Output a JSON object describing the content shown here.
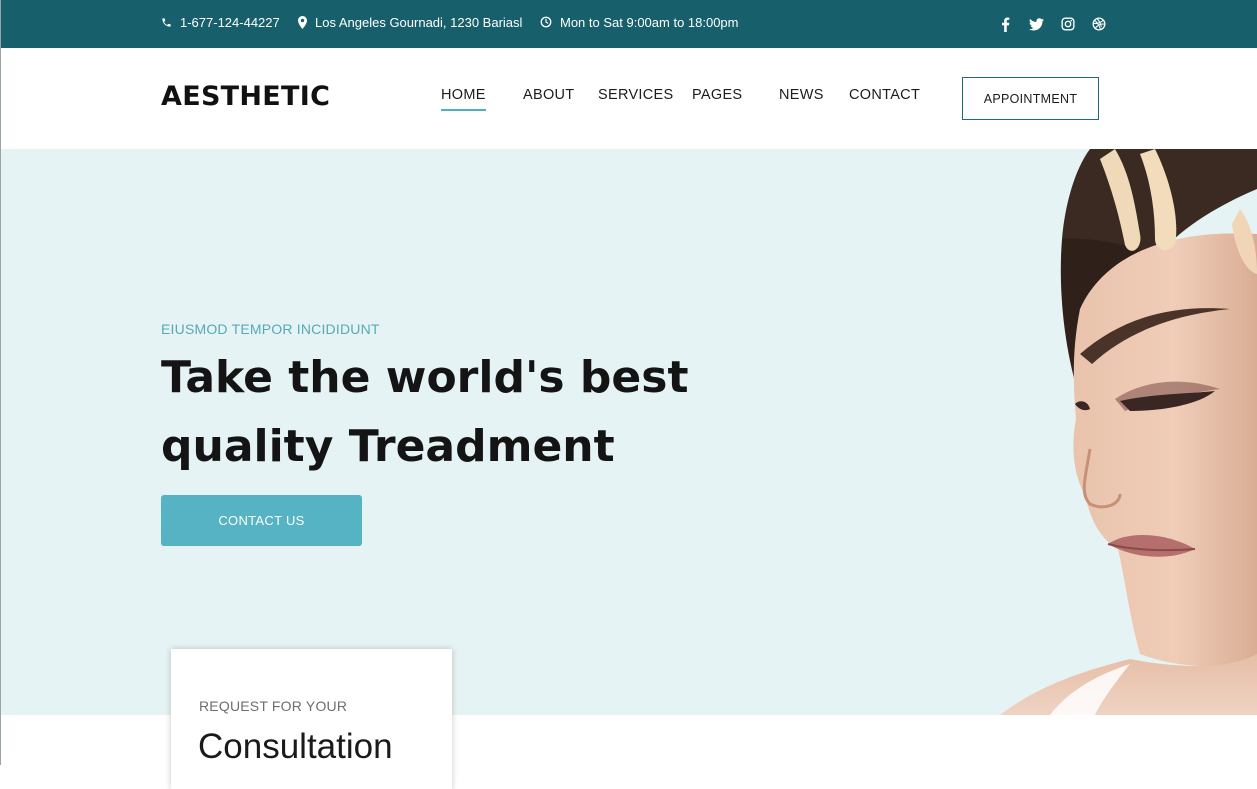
{
  "topbar": {
    "phone": "1-677-124-44227",
    "address": "Los Angeles Gournadi, 1230 Bariasl",
    "hours": "Mon to Sat 9:00am to 18:00pm",
    "social": [
      "facebook-icon",
      "twitter-icon",
      "instagram-icon",
      "dribbble-icon"
    ]
  },
  "header": {
    "logo": "AESTHETIC",
    "nav": [
      {
        "label": "HOME",
        "active": true
      },
      {
        "label": "ABOUT"
      },
      {
        "label": "SERVICES"
      },
      {
        "label": "PAGES"
      },
      {
        "label": "NEWS"
      },
      {
        "label": "CONTACT"
      }
    ],
    "appointment": "APPOINTMENT"
  },
  "hero": {
    "subtitle": "EIUSMOD TEMPOR INCIDIDUNT",
    "title_line1": "Take the world's best",
    "title_line2": "quality Treadment",
    "button": "CONTACT US"
  },
  "card": {
    "subtitle": "REQUEST FOR YOUR",
    "title": "Consultation"
  },
  "colors": {
    "topbar": "#165f6b",
    "accent": "#55b3c4",
    "hero_bg": "#e6f3f4"
  }
}
